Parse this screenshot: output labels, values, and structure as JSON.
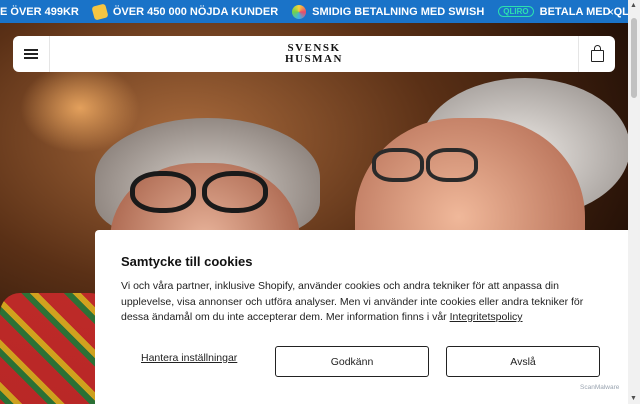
{
  "announcement": {
    "items": [
      {
        "text": "E ÖVER 499KR",
        "icon": "none"
      },
      {
        "text": "ÖVER 450 000 NÖJDA KUNDER",
        "icon": "thumbs-up-icon"
      },
      {
        "text": "SMIDIG BETALNING MED SWISH",
        "icon": "swish-icon"
      },
      {
        "text": "BETALA MED QLIRO",
        "icon": "qliro-icon",
        "badge": "QLIRO"
      }
    ],
    "close_label": "×"
  },
  "header": {
    "logo_line1": "SVENSK",
    "logo_line2": "HUSMAN"
  },
  "cookie": {
    "title": "Samtycke till cookies",
    "body": "Vi och våra partner, inklusive Shopify, använder cookies och andra tekniker för att anpassa din upplevelse, visa annonser och utföra analyser. Men vi använder inte cookies eller andra tekniker för dessa ändamål om du inte accepterar dem. Mer information finns i vår",
    "policy_link": "Integritetspolicy",
    "manage_label": "Hantera inställningar",
    "accept_label": "Godkänn",
    "decline_label": "Avslå"
  },
  "watermark": "ScanMalware",
  "colors": {
    "announcement_bg": "#1a73c8",
    "text": "#222222"
  }
}
